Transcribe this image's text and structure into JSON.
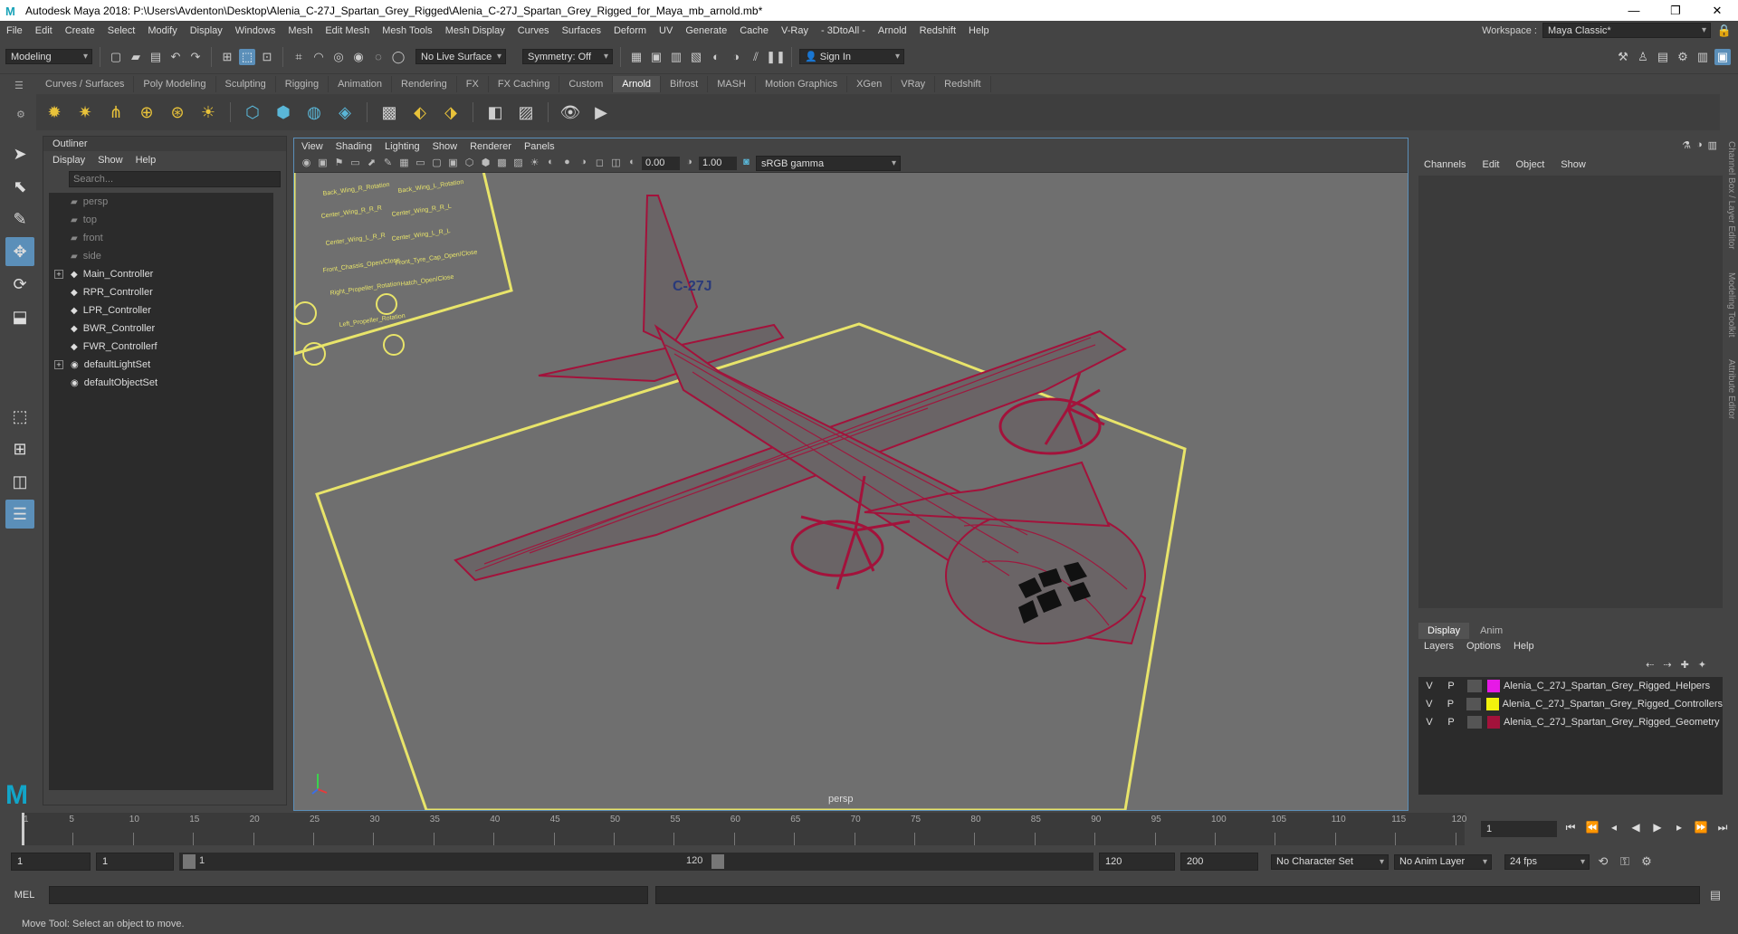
{
  "title": "Autodesk Maya 2018: P:\\Users\\Avdenton\\Desktop\\Alenia_C-27J_Spartan_Grey_Rigged\\Alenia_C-27J_Spartan_Grey_Rigged_for_Maya_mb_arnold.mb*",
  "menus": [
    "File",
    "Edit",
    "Create",
    "Select",
    "Modify",
    "Display",
    "Windows",
    "Mesh",
    "Edit Mesh",
    "Mesh Tools",
    "Mesh Display",
    "Curves",
    "Surfaces",
    "Deform",
    "UV",
    "Generate",
    "Cache",
    "V-Ray",
    "- 3DtoAll -",
    "Arnold",
    "Redshift",
    "Help"
  ],
  "workspace_label": "Workspace :",
  "workspace_value": "Maya Classic*",
  "mode": "Modeling",
  "live_surface": "No Live Surface",
  "symmetry": "Symmetry: Off",
  "sign_in": "Sign In",
  "shelf_tabs": [
    "Curves / Surfaces",
    "Poly Modeling",
    "Sculpting",
    "Rigging",
    "Animation",
    "Rendering",
    "FX",
    "FX Caching",
    "Custom",
    "Arnold",
    "Bifrost",
    "MASH",
    "Motion Graphics",
    "XGen",
    "VRay",
    "Redshift"
  ],
  "active_shelf": "Arnold",
  "outliner": {
    "title": "Outliner",
    "menu": [
      "Display",
      "Show",
      "Help"
    ],
    "search_placeholder": "Search...",
    "items": [
      {
        "label": "persp",
        "dim": true
      },
      {
        "label": "top",
        "dim": true
      },
      {
        "label": "front",
        "dim": true
      },
      {
        "label": "side",
        "dim": true
      },
      {
        "label": "Main_Controller",
        "exp": true
      },
      {
        "label": "RPR_Controller"
      },
      {
        "label": "LPR_Controller"
      },
      {
        "label": "BWR_Controller"
      },
      {
        "label": "FWR_Controllerf"
      },
      {
        "label": "defaultLightSet",
        "exp": true
      },
      {
        "label": "defaultObjectSet"
      }
    ]
  },
  "viewport": {
    "menu": [
      "View",
      "Shading",
      "Lighting",
      "Show",
      "Renderer",
      "Panels"
    ],
    "exposure": "0.00",
    "gamma": "1.00",
    "colorspace": "sRGB gamma",
    "camera": "persp"
  },
  "channelbox": {
    "menu": [
      "Channels",
      "Edit",
      "Object",
      "Show"
    ],
    "layer_tabs": [
      "Display",
      "Anim"
    ],
    "layer_menu": [
      "Layers",
      "Options",
      "Help"
    ],
    "layers": [
      {
        "v": "V",
        "p": "P",
        "name": "Alenia_C_27J_Spartan_Grey_Rigged_Helpers",
        "color": "#e619e6"
      },
      {
        "v": "V",
        "p": "P",
        "name": "Alenia_C_27J_Spartan_Grey_Rigged_Controllers",
        "color": "#f2f20d"
      },
      {
        "v": "V",
        "p": "P",
        "name": "Alenia_C_27J_Spartan_Grey_Rigged_Geometry",
        "color": "#a3123b"
      }
    ]
  },
  "side_tabs": [
    "Channel Box / Layer Editor",
    "Modeling Toolkit",
    "Attribute Editor"
  ],
  "timeline": {
    "ticks": [
      "5",
      "10",
      "15",
      "20",
      "25",
      "30",
      "35",
      "40",
      "45",
      "50",
      "55",
      "60",
      "65",
      "70",
      "75",
      "80",
      "85",
      "90",
      "95",
      "100",
      "105",
      "110",
      "115",
      "120"
    ],
    "first": "1",
    "current": "1"
  },
  "range": {
    "start": "1",
    "start2": "1",
    "bar_start": "1",
    "bar_end": "120",
    "end": "120",
    "end2": "200",
    "char_set": "No Character Set",
    "anim_layer": "No Anim Layer",
    "fps": "24 fps"
  },
  "mel": "MEL",
  "help_line": "Move Tool: Select an object to move.",
  "controls_panel": [
    "Back_Wing_R_Rotation",
    "Back_Wing_L_Rotation",
    "Center_Wing_R_R_R",
    "Center_Wing_R_R_L",
    "Center_Wing_L_R_R",
    "Center_Wing_L_R_L",
    "Front_Chassis_Open/Close",
    "Front_Tyre_Cap_Open/Close",
    "Right_Propeller_Rotation",
    "Hatch_Open/Close",
    "Left_Propeller_Rotation"
  ]
}
